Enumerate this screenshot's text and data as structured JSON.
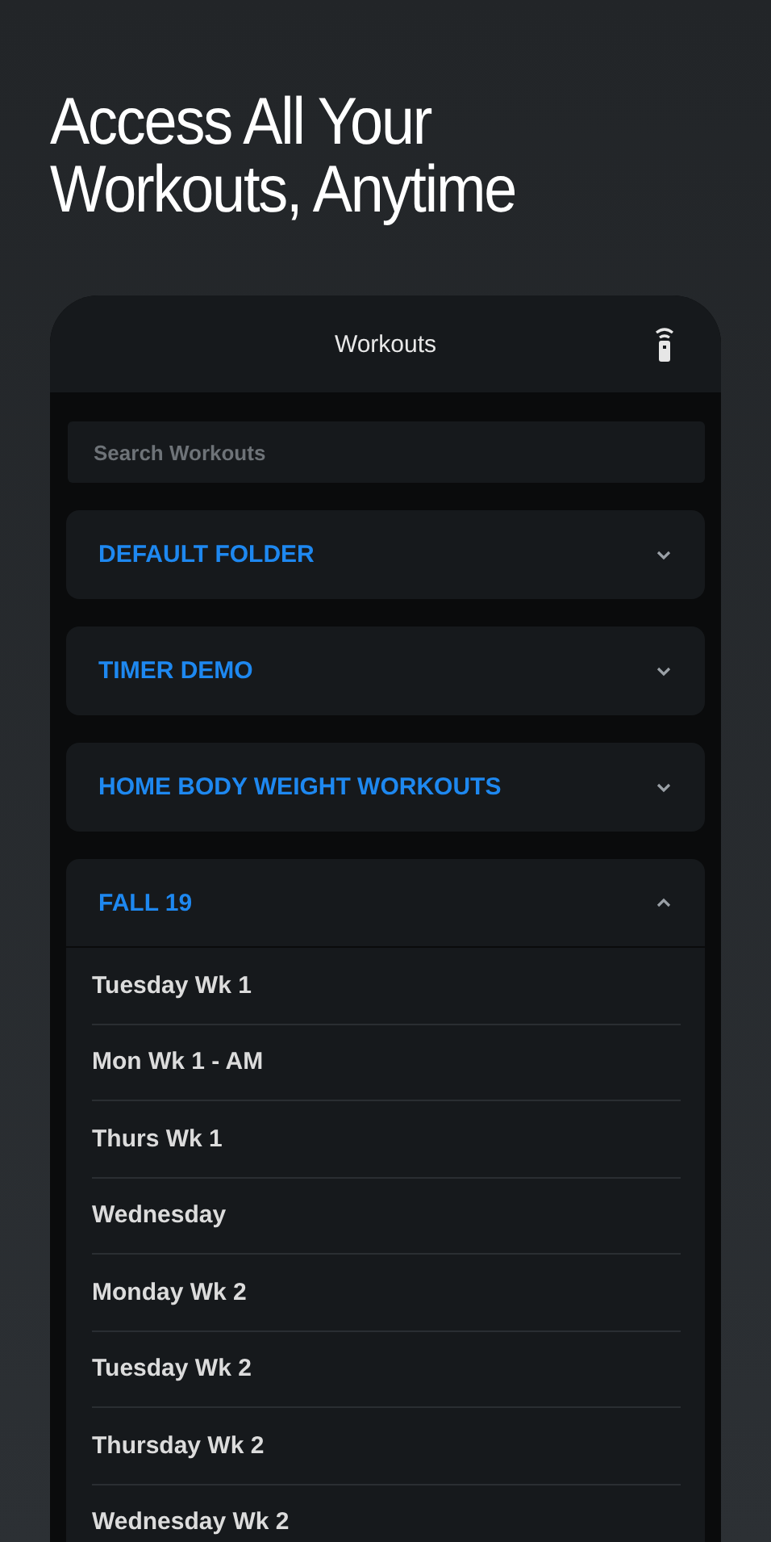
{
  "headline": "Access All Your Workouts, Anytime",
  "screen": {
    "title": "Workouts"
  },
  "search": {
    "placeholder": "Search Workouts"
  },
  "folders": [
    {
      "name": "DEFAULT FOLDER",
      "expanded": false
    },
    {
      "name": "TIMER DEMO",
      "expanded": false
    },
    {
      "name": "HOME BODY WEIGHT WORKOUTS",
      "expanded": false
    },
    {
      "name": "FALL 19",
      "expanded": true,
      "children": [
        {
          "name": "Tuesday Wk 1"
        },
        {
          "name": "Mon Wk 1 - AM"
        },
        {
          "name": "Thurs Wk 1"
        },
        {
          "name": "Wednesday"
        },
        {
          "name": "Monday Wk 2"
        },
        {
          "name": "Tuesday Wk 2"
        },
        {
          "name": "Thursday Wk 2"
        },
        {
          "name": "Wednesday Wk 2"
        }
      ]
    }
  ]
}
